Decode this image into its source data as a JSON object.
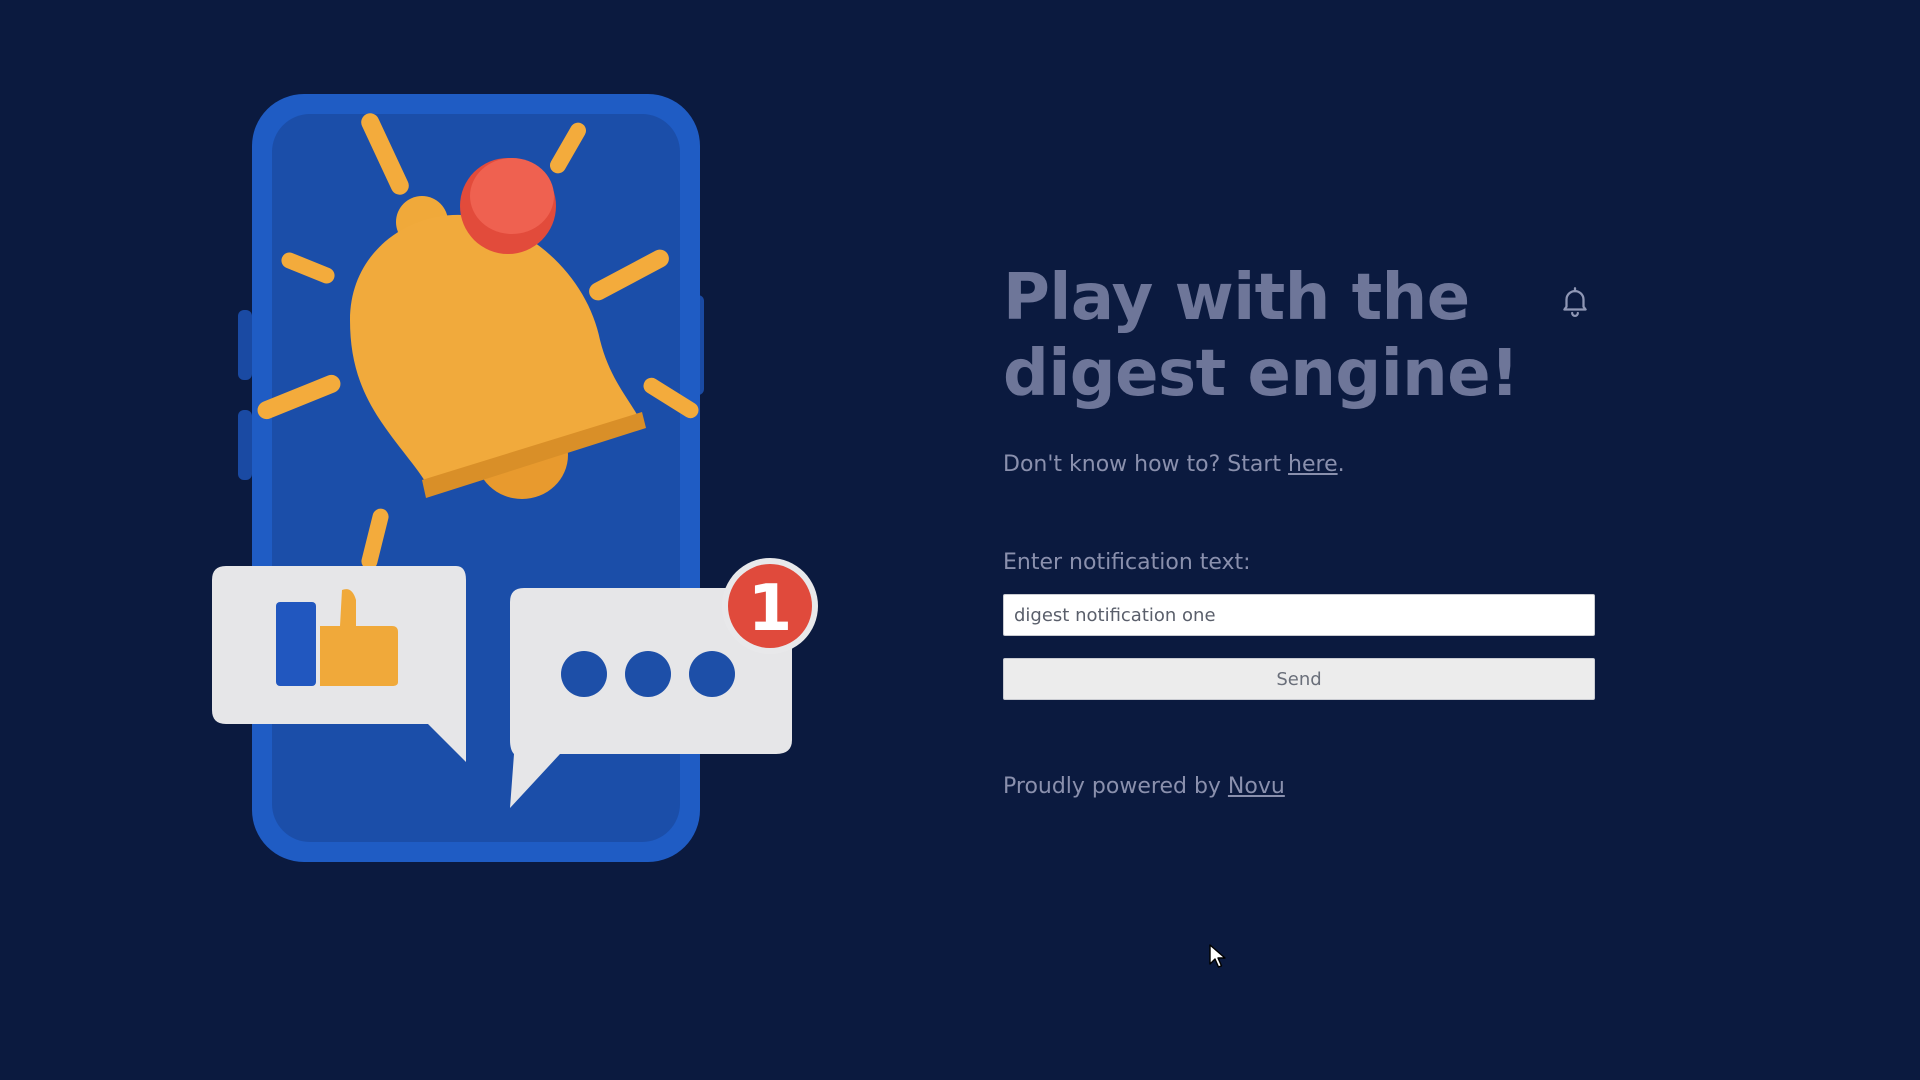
{
  "hero": {
    "illustration": "phone-with-bell-illustration",
    "badge_count": "1",
    "colors": {
      "background": "#0b1a3f",
      "phone": "#1d56b8",
      "bell": "#f0a93a",
      "badge": "#e04a3c",
      "bubble": "#e6e6e8"
    }
  },
  "main": {
    "headline": "Play with the digest engine!",
    "help_prefix": "Don't know how to? Start ",
    "help_link": "here",
    "help_suffix": ".",
    "bell_icon": "bell-outline-icon",
    "input_label": "Enter notification text:",
    "input_value": "digest notification one",
    "send_label": "Send",
    "powered_prefix": "Proudly powered by ",
    "powered_link": "Novu"
  }
}
